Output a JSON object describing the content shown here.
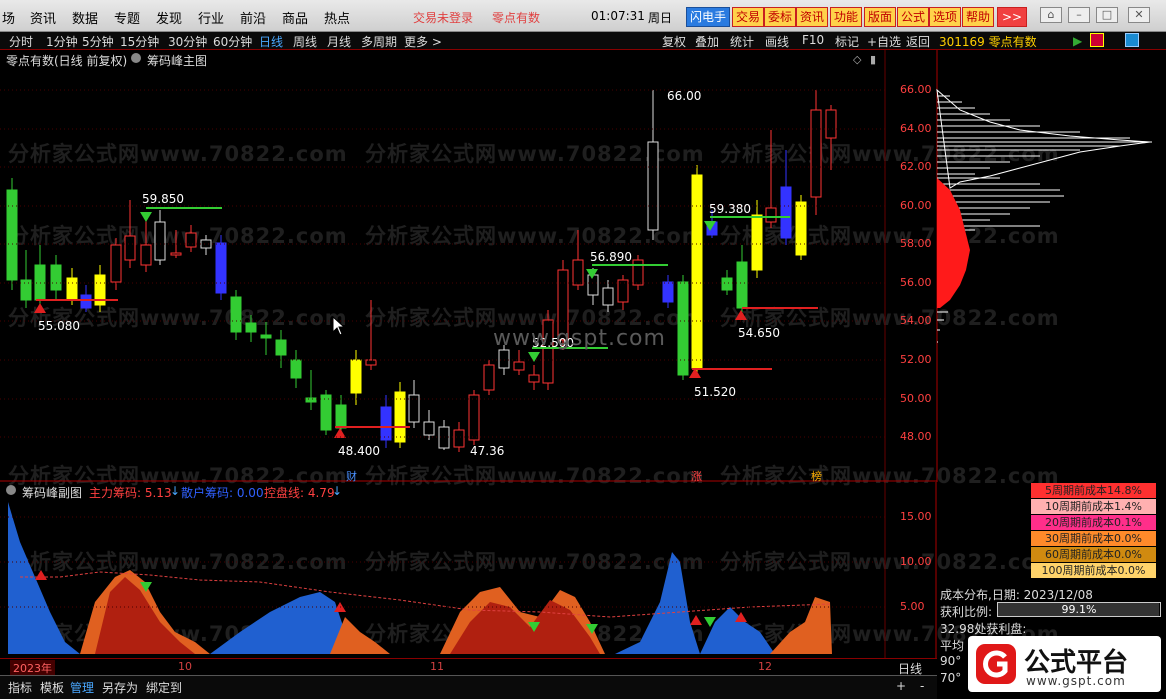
{
  "menubar": {
    "items": [
      "场",
      "资讯",
      "数据",
      "专题",
      "发现",
      "行业",
      "前沿",
      "商品",
      "热点"
    ],
    "login_status": "交易未登录",
    "stock_name_top": "零点有数",
    "time": "01:07:31",
    "weekday": "周日",
    "tool_buttons": [
      "闪电手",
      "交易",
      "委标",
      "资讯",
      "功能",
      "版面",
      "公式",
      "选项",
      "帮助"
    ],
    "more": ">>"
  },
  "periodbar": {
    "periods": [
      "分时",
      "1分钟",
      "5分钟",
      "15分钟",
      "30分钟",
      "60分钟",
      "日线",
      "周线",
      "月线",
      "多周期",
      "更多 >"
    ],
    "active": "日线",
    "right_items": [
      "复权",
      "叠加",
      "统计",
      "画线",
      "F10",
      "标记",
      "+自选",
      "返回"
    ],
    "stock_code_name": "301169 零点有数"
  },
  "main": {
    "title": "零点有数(日线 前复权)",
    "indicator": "筹码峰主图",
    "price_labels": [
      "59.850",
      "55.080",
      "48.400",
      "47.36",
      "52.500",
      "56.890",
      "66.00",
      "59.380",
      "54.650",
      "51.520"
    ],
    "axis_ticks": [
      "66.00",
      "64.00",
      "62.00",
      "60.00",
      "58.00",
      "56.00",
      "54.00",
      "52.00",
      "50.00",
      "48.00"
    ],
    "markers": [
      "财",
      "涨",
      "榜"
    ],
    "watermark": "分析家公式网www.70822.com",
    "site_watermark": "www.gspt.com"
  },
  "sub": {
    "title": "筹码峰副图",
    "main_chip": "主力筹码: 5.13",
    "retail_chip": "散户筹码: 0.00",
    "control_line": "控盘线: 4.79",
    "axis_ticks": [
      "15.00",
      "10.00",
      "5.00"
    ]
  },
  "timeline": {
    "labels": [
      "2023年",
      "10",
      "11",
      "12"
    ],
    "right_label": "日线"
  },
  "legend": {
    "rows": [
      {
        "text": "5周期前成本14.8%",
        "color": "#ff3030"
      },
      {
        "text": "10周期前成本1.4%",
        "color": "#ffb0b0"
      },
      {
        "text": "20周期前成本0.1%",
        "color": "#ff2e8a"
      },
      {
        "text": "30周期前成本0.0%",
        "color": "#ff8a2a"
      },
      {
        "text": "60周期前成本0.0%",
        "color": "#d08a10"
      },
      {
        "text": "100周期前成本0.0%",
        "color": "#ffd36a"
      }
    ]
  },
  "info": {
    "cost_line": "成本分布,日期: 2023/12/08",
    "profit_label": "获利比例:",
    "profit_value": "99.1%",
    "profit_fraction": 0.991,
    "profit_disk": "32.98处获利盘:",
    "row3": "平均",
    "row4": "90°",
    "row5": "70°"
  },
  "statusbar": {
    "items": [
      "指标",
      "模板",
      "管理",
      "另存为",
      "绑定到"
    ],
    "active": "管理",
    "plus": "+",
    "minus": "-"
  },
  "logo": {
    "text": "公式平台",
    "url": "www.gspt.com"
  }
}
